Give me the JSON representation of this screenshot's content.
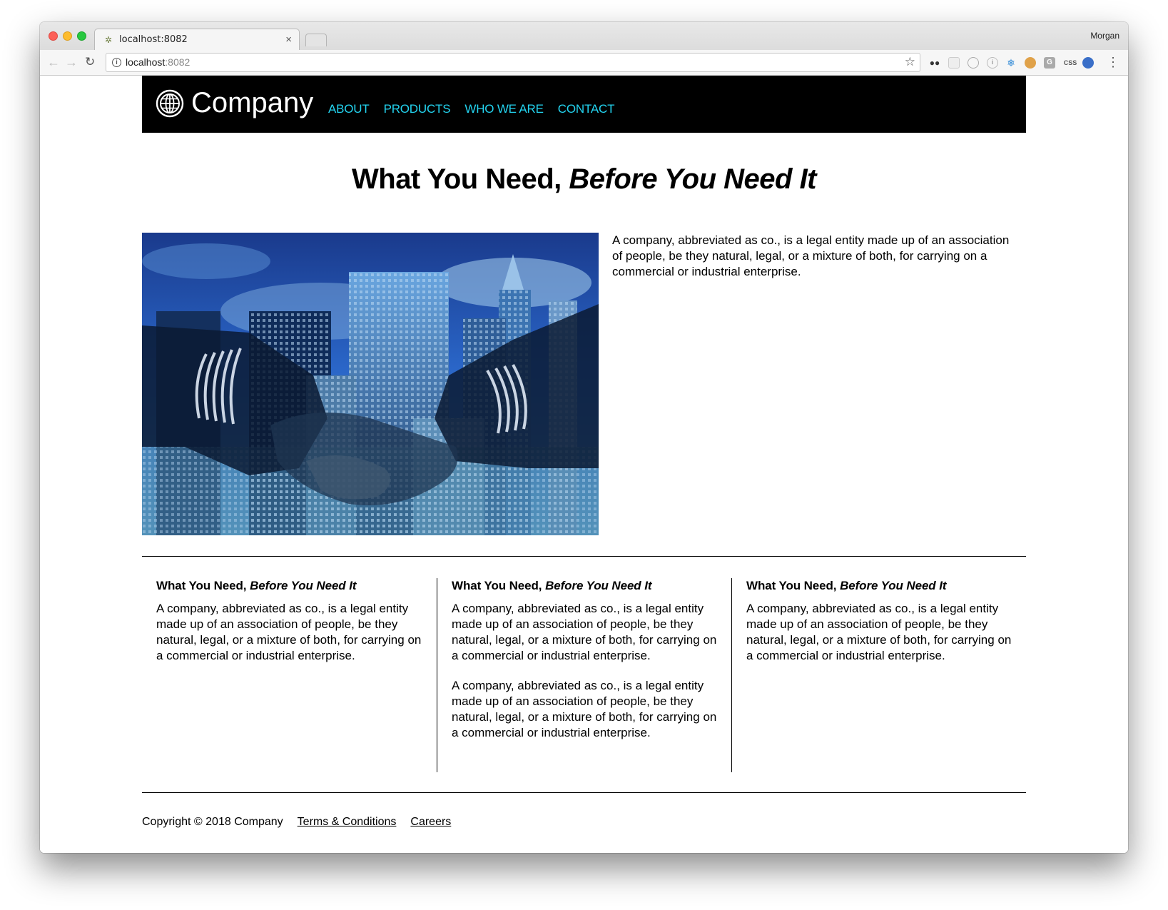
{
  "browser": {
    "tab_title": "localhost:8082",
    "tab_close": "×",
    "profile_name": "Morgan",
    "url_host": "localhost",
    "url_port": ":8082",
    "extensions": [
      "glasses-ext-icon",
      "grid-ext-icon",
      "circle-ext-icon",
      "info-ext-icon",
      "snowflake-ext-icon",
      "cookie-ext-icon",
      "g-ext-icon",
      "css-ext-icon",
      "globe-ext-icon"
    ],
    "css_ext_label": "CSS",
    "g_ext_label": "G"
  },
  "header": {
    "brand": "Company",
    "nav": [
      "ABOUT",
      "PRODUCTS",
      "WHO WE ARE",
      "CONTACT"
    ],
    "accent_color": "#23d4f0",
    "background": "#000000"
  },
  "hero": {
    "title_plain": "What You Need, ",
    "title_italic": "Before You Need It",
    "text": "A company, abbreviated as co., is a legal entity made up of an association of people, be they natural, legal, or a mixture of both, for carrying on a commercial or industrial enterprise."
  },
  "columns": [
    {
      "title_plain": "What You Need, ",
      "title_italic": "Before You Need It",
      "paragraphs": [
        "A company, abbreviated as co., is a legal entity made up of an association of people, be they natural, legal, or a mixture of both, for carrying on a commercial or industrial enterprise."
      ]
    },
    {
      "title_plain": "What You Need, ",
      "title_italic": "Before You Need It",
      "paragraphs": [
        "A company, abbreviated as co., is a legal entity made up of an association of people, be they natural, legal, or a mixture of both, for carrying on a commercial or industrial enterprise.",
        "A company, abbreviated as co., is a legal entity made up of an association of people, be they natural, legal, or a mixture of both, for carrying on a commercial or industrial enterprise."
      ]
    },
    {
      "title_plain": "What You Need, ",
      "title_italic": "Before You Need It",
      "paragraphs": [
        "A company, abbreviated as co., is a legal entity made up of an association of people, be they natural, legal, or a mixture of both, for carrying on a commercial or industrial enterprise."
      ]
    }
  ],
  "footer": {
    "copyright": "Copyright © 2018 Company",
    "links": [
      "Terms & Conditions",
      "Careers"
    ]
  }
}
